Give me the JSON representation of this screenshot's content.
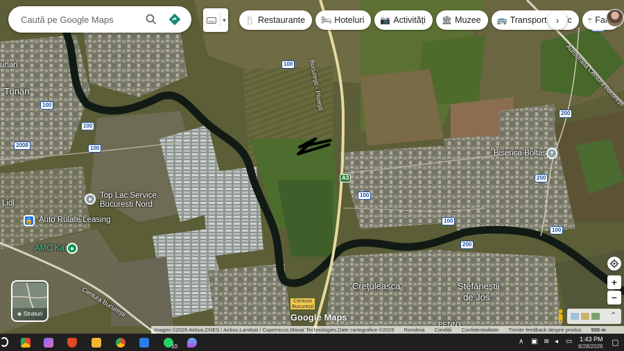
{
  "search": {
    "placeholder": "Caută pe Google Maps"
  },
  "chips": [
    {
      "icon": "fork-knife-icon",
      "glyph": "🍴",
      "label": "Restaurante"
    },
    {
      "icon": "bed-icon",
      "glyph": "🛏",
      "label": "Hoteluri"
    },
    {
      "icon": "camera-icon",
      "glyph": "📷",
      "label": "Activități"
    },
    {
      "icon": "museum-icon",
      "glyph": "🏛",
      "label": "Muzee"
    },
    {
      "icon": "bus-icon",
      "glyph": "🚌",
      "label": "Transport public"
    },
    {
      "icon": "pharmacy-icon",
      "glyph": "⚕",
      "label": "Far"
    }
  ],
  "places": {
    "tunari": "Tunari",
    "tunari_small": "unari",
    "lidl": "Lidl",
    "top_lac_1": "Top Lac Service",
    "top_lac_2": "Bucuresti Nord",
    "auto_rulate": "Auto Rulate Leasing",
    "amc_kart": "AMC Kart",
    "biserica": "Biserica Boltasu",
    "creteuleasca": "Creţuleasca",
    "stefanesti_1": "Ştefăneştii",
    "stefanesti_2": "de Jos",
    "penny": "PENNY"
  },
  "roads": {
    "bucuresti_ploiesti": "București - Ploiești",
    "centura_right": "Autostrada Centura București",
    "centura_left": "Centura București",
    "centura_tag_1": "Centura",
    "centura_tag_2": "București"
  },
  "shields": {
    "r100": "100",
    "r200": "200",
    "r2008": "2008",
    "a3": "A3"
  },
  "layers": {
    "label": "Straturi"
  },
  "controls": {
    "zoom_in": "+",
    "zoom_out": "−"
  },
  "attribution": {
    "imagery": "Imagini ©2026 Airbus,CNES / Airbus,Landsat / Copernicus,Maxar Technologies,Date cartografice ©2026",
    "country": "România",
    "terms": "Condiții",
    "privacy": "Confidențialitate",
    "feedback": "Trimite feedback despre produs",
    "scale": "500 m"
  },
  "logo": "Google Maps",
  "taskbar": {
    "badge": "10",
    "time": "1:43 PM",
    "date": "8/28/2026"
  }
}
